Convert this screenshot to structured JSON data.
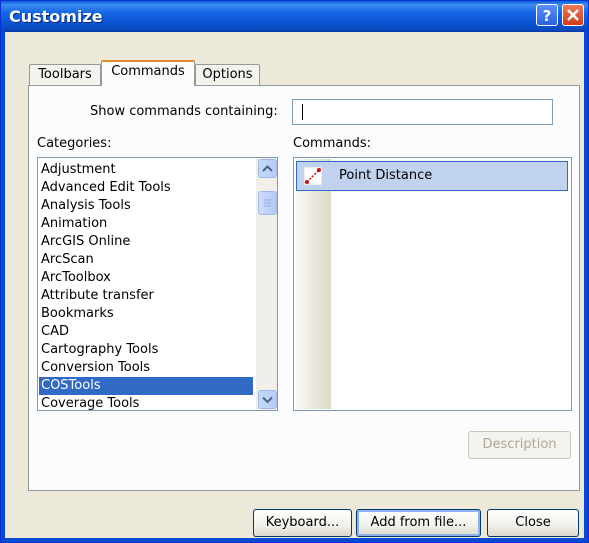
{
  "window": {
    "title": "Customize"
  },
  "tabs": [
    {
      "label": "Toolbars"
    },
    {
      "label": "Commands"
    },
    {
      "label": "Options"
    }
  ],
  "search": {
    "label": "Show commands containing:",
    "value": ""
  },
  "categories": {
    "label": "Categories:",
    "items": [
      "Adjustment",
      "Advanced Edit Tools",
      "Analysis Tools",
      "Animation",
      "ArcGIS Online",
      "ArcScan",
      "ArcToolbox",
      "Attribute transfer",
      "Bookmarks",
      "CAD",
      "Cartography Tools",
      "Conversion Tools",
      "COSTools",
      "Coverage Tools"
    ],
    "selected": "COSTools"
  },
  "commands": {
    "label": "Commands:",
    "items": [
      {
        "label": "Point Distance",
        "icon": "point-distance-icon"
      }
    ]
  },
  "buttons": {
    "description": "Description",
    "keyboard": "Keyboard...",
    "add_from_file": "Add from file...",
    "close": "Close"
  }
}
